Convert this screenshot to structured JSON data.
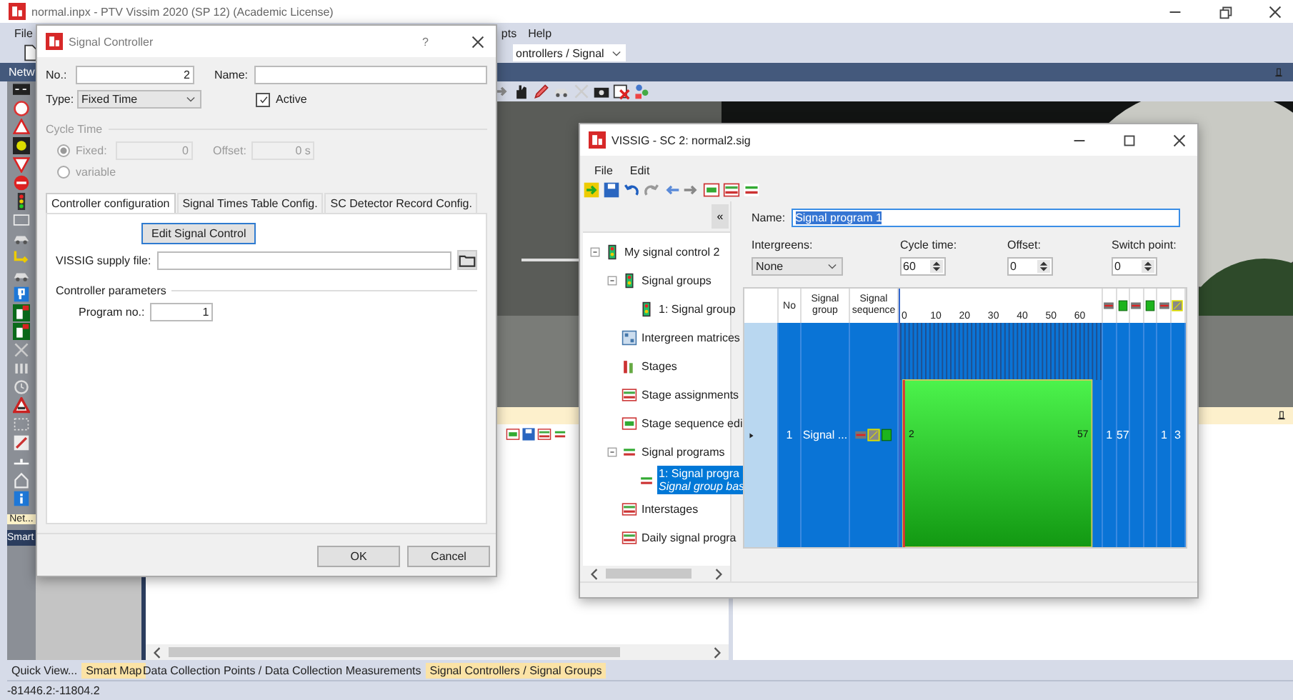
{
  "app": {
    "title": "normal.inpx - PTV Vissim 2020 (SP 12) (Academic License)",
    "menu_left": [
      {
        "label": "File"
      }
    ],
    "menu_right": [
      {
        "label": "pts"
      },
      {
        "label": "Help"
      }
    ],
    "list_selector": {
      "value": "ontrollers / Signal"
    },
    "network_panel": {
      "title": "Netw"
    },
    "left_pane_tab": {
      "label": "Net...",
      "selected": true
    },
    "smart_panel": {
      "title": "Smart"
    },
    "bottom_left_tabs": [
      {
        "label": "Quick View...",
        "selected": false
      },
      {
        "label": "Smart Map",
        "selected": true
      }
    ],
    "bottom_list_tabs": [
      {
        "label": "Data Collection Points / Data Collection Measurements",
        "selected": false
      },
      {
        "label": "Signal Controllers / Signal Groups",
        "selected": true
      }
    ],
    "status_bar": {
      "coordinates": "-81446.2:-11804.2"
    }
  },
  "signal_controller": {
    "title": "Signal Controller",
    "help_button": "?",
    "no": {
      "label": "No.:",
      "value": "2"
    },
    "name": {
      "label": "Name:"
    },
    "type": {
      "label": "Type:",
      "value": "Fixed Time"
    },
    "active": {
      "label": "Active",
      "checked": true
    },
    "cycle_time": {
      "title": "Cycle Time",
      "disabled": true,
      "options": [
        {
          "label": "Fixed:",
          "selected": true
        },
        {
          "label": "variable",
          "selected": false
        }
      ],
      "fixed_value": "0",
      "offset": {
        "label": "Offset:",
        "value": "0 s"
      }
    },
    "tabs": [
      {
        "label": "Controller configuration",
        "selected": true
      },
      {
        "label": "Signal Times Table Config.",
        "selected": false
      },
      {
        "label": "SC Detector Record Config.",
        "selected": false
      }
    ],
    "edit_button": "Edit Signal Control",
    "supply_file": {
      "label": "VISSIG supply file:"
    },
    "parameters": {
      "title": "Controller parameters",
      "program_no": {
        "label": "Program no.:",
        "value": "1"
      }
    },
    "buttons": [
      {
        "label": "OK"
      },
      {
        "label": "Cancel"
      }
    ]
  },
  "vissig": {
    "title": "VISSIG - SC 2: normal2.sig",
    "menu": [
      {
        "label": "File"
      },
      {
        "label": "Edit"
      }
    ],
    "collapse_button": "«",
    "tree": [
      {
        "label": "My signal control 2",
        "expanded": true,
        "selected": false,
        "children": [
          {
            "label": "Signal groups",
            "expanded": true,
            "selected": false,
            "children": [
              {
                "label": "1: Signal group",
                "selected": false
              }
            ]
          },
          {
            "label": "Intergreen matrices",
            "selected": false
          },
          {
            "label": "Stages",
            "selected": false
          },
          {
            "label": "Stage assignments",
            "selected": false
          },
          {
            "label": "Stage sequence edi",
            "selected": false
          },
          {
            "label": "Signal programs",
            "expanded": true,
            "selected": false,
            "children": [
              {
                "label": "1: Signal progra",
                "sublabel": "Signal group bas",
                "selected": true
              }
            ]
          },
          {
            "label": "Interstages",
            "selected": false
          },
          {
            "label": "Daily signal progra",
            "selected": false
          }
        ]
      }
    ],
    "program": {
      "name": {
        "label": "Name:",
        "value": "Signal program 1"
      },
      "intergreens": {
        "label": "Intergreens:",
        "value": "None"
      },
      "cycle_time": {
        "label": "Cycle time:",
        "value": "60"
      },
      "offset": {
        "label": "Offset:",
        "value": "0"
      },
      "switch_point": {
        "label": "Switch point:",
        "value": "0"
      }
    },
    "table": {
      "columns": [
        "No",
        "Signal group",
        "Signal sequence"
      ],
      "ticks": [
        "0",
        "10",
        "20",
        "30",
        "40",
        "50",
        "60"
      ],
      "rows": [
        {
          "no": "1",
          "signal_group": "Signal ...",
          "green_start": "2",
          "green_end": "57",
          "end_values": [
            "1",
            "57"
          ],
          "extra_values": [
            "1",
            "3"
          ],
          "selected": true
        }
      ]
    }
  }
}
